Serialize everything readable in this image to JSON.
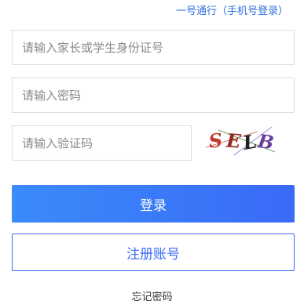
{
  "header": {
    "one_pass_link": "一号通行（手机号登录）"
  },
  "form": {
    "id_field": {
      "placeholder": "请输入家长或学生身份证号",
      "value": ""
    },
    "password_field": {
      "placeholder": "请输入密码",
      "value": ""
    },
    "captcha_field": {
      "placeholder": "请输入验证码",
      "value": ""
    },
    "captcha_image": {
      "text": [
        "S",
        "E",
        "L",
        "B"
      ]
    },
    "login_label": "登录",
    "register_label": "注册账号",
    "forgot_label": "忘记密码"
  },
  "colors": {
    "accent": "#3a6af7",
    "accent_light": "#3b8bfa",
    "link": "#2f6fe0",
    "border": "#dcdcdc"
  }
}
